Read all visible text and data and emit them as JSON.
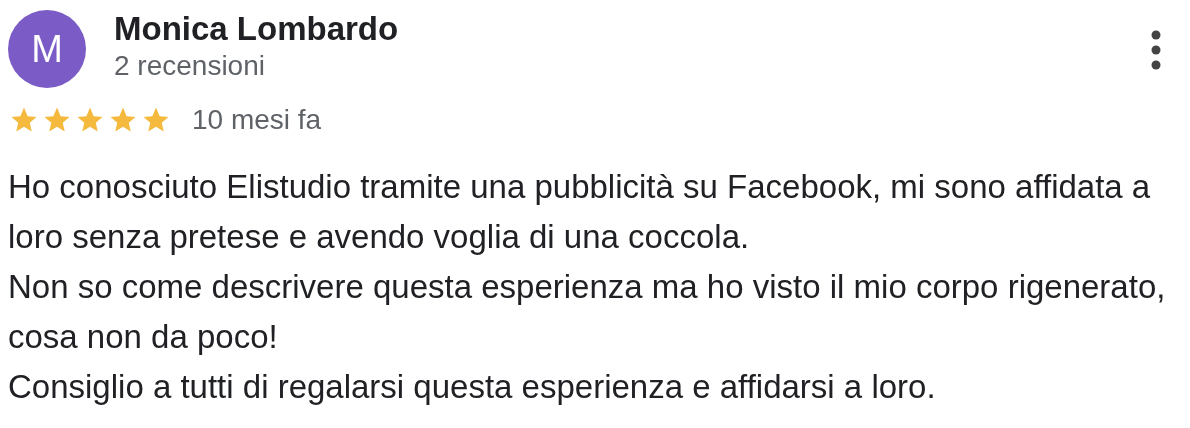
{
  "review": {
    "avatar_letter": "M",
    "author": "Monica Lombardo",
    "subtitle": "2 recensioni",
    "stars": 5,
    "time": "10 mesi fa",
    "paragraphs": [
      "Ho conosciuto Elistudio tramite una pubblicità su Facebook, mi sono affidata a loro senza pretese e avendo voglia di una coccola.",
      "Non so come descrivere questa esperienza ma ho visto il mio corpo rigenerato, cosa non da poco!",
      "Consiglio a tutti di regalarsi questa esperienza e affidarsi a loro."
    ]
  }
}
